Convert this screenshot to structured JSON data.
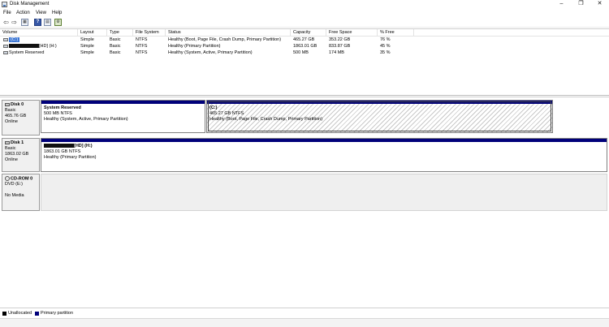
{
  "window": {
    "title": "Disk Management"
  },
  "menu": [
    "File",
    "Action",
    "View",
    "Help"
  ],
  "volume_table": {
    "columns": [
      "Volume",
      "Layout",
      "Type",
      "File System",
      "Status",
      "Capacity",
      "Free Space",
      "% Free"
    ],
    "rows": [
      {
        "volume": "(C:)",
        "layout": "Simple",
        "type": "Basic",
        "fs": "NTFS",
        "status": "Healthy (Boot, Page File, Crash Dump, Primary Partition)",
        "capacity": "465.27 GB",
        "free": "353.22 GB",
        "pct": "76 %"
      },
      {
        "volume": "[HD] (H:)",
        "layout": "Simple",
        "type": "Basic",
        "fs": "NTFS",
        "status": "Healthy (Primary Partition)",
        "capacity": "1863.01 GB",
        "free": "833.87 GB",
        "pct": "45 %"
      },
      {
        "volume": "System Reserved",
        "layout": "Simple",
        "type": "Basic",
        "fs": "NTFS",
        "status": "Healthy (System, Active, Primary Partition)",
        "capacity": "500 MB",
        "free": "174 MB",
        "pct": "35 %"
      }
    ]
  },
  "disks": [
    {
      "name": "Disk 0",
      "type": "Basic",
      "size": "465.76 GB",
      "state": "Online",
      "partitions": [
        {
          "name": "System Reserved",
          "size": "500 MB NTFS",
          "status": "Healthy (System, Active, Primary Partition)"
        },
        {
          "name": "(C:)",
          "size": "465.27 GB NTFS",
          "status": "Healthy (Boot, Page File, Crash Dump, Primary Partition)"
        }
      ]
    },
    {
      "name": "Disk 1",
      "type": "Basic",
      "size": "1863.02 GB",
      "state": "Online",
      "partitions": [
        {
          "name": "[HD]  (H:)",
          "size": "1863.01 GB NTFS",
          "status": "Healthy (Primary Partition)"
        }
      ]
    },
    {
      "name": "CD-ROM 0",
      "type": "DVD (E:)",
      "state": "No Media"
    }
  ],
  "legend": [
    {
      "label": "Unallocated",
      "color": "#000000"
    },
    {
      "label": "Primary partition",
      "color": "#00007a"
    }
  ],
  "icons": {
    "back": "back-arrow-icon",
    "forward": "forward-arrow-icon",
    "properties": "properties-icon",
    "help": "help-icon",
    "refresh": "refresh-icon",
    "settings": "settings-icon"
  }
}
